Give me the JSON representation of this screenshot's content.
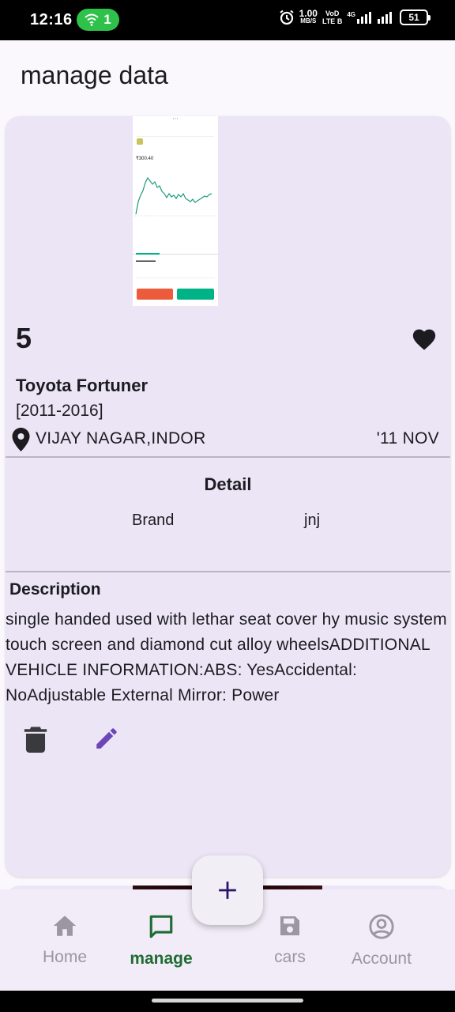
{
  "status_bar": {
    "time": "12:16",
    "wifi_badge": "1",
    "net_speed_value": "1.00",
    "net_speed_unit": "MB/S",
    "volte_top": "VoD",
    "volte_bottom": "LTE B",
    "signal_label": "4G",
    "battery": "51"
  },
  "app_bar": {
    "title": "manage data"
  },
  "listing": {
    "number": "5",
    "name": "Toyota Fortuner",
    "years": "[2011-2016]",
    "location": "VIJAY NAGAR,INDOR",
    "date": "'11 NOV",
    "detail_heading": "Detail",
    "detail_key": "Brand",
    "detail_value": "jnj",
    "description_heading": "Description",
    "description": "single handed used with lethar seat cover hy music system touch screen and diamond cut alloy wheelsADDITIONAL VEHICLE INFORMATION:ABS: YesAccidental: NoAdjustable External Mirror: Power",
    "thumbnail_price": "₹300.40"
  },
  "nav": {
    "items": [
      {
        "label": "Home",
        "icon": "home-icon"
      },
      {
        "label": "manage",
        "icon": "chat-icon",
        "active": true
      },
      {
        "label": "cars",
        "icon": "save-icon"
      },
      {
        "label": "Account",
        "icon": "account-icon"
      }
    ]
  },
  "fab": {
    "icon": "plus-icon"
  },
  "colors": {
    "card_bg": "#ebe5f6",
    "nav_bg": "#f1ecf7",
    "active_green": "#1f6b33",
    "edit_purple": "#6c45b8",
    "fab_plus": "#2b1469"
  }
}
